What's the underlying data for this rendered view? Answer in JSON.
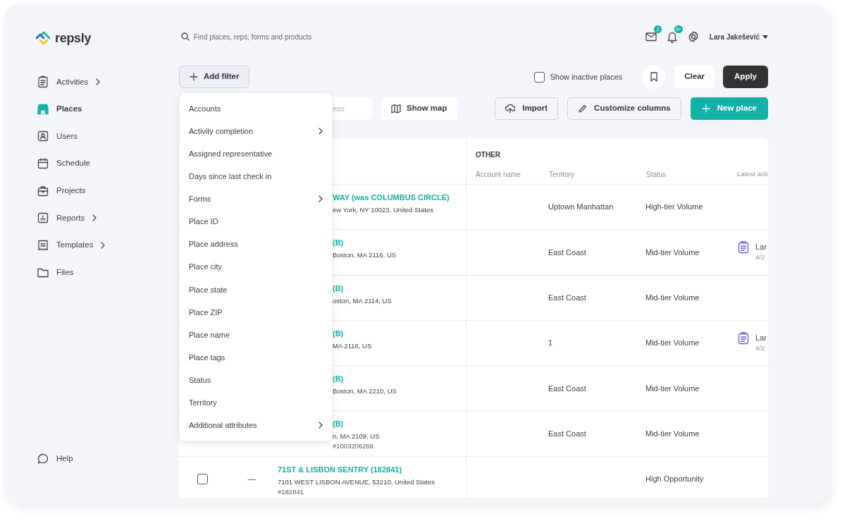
{
  "brand": "repsly",
  "sidebar": {
    "items": [
      {
        "label": "Activities",
        "selected": false,
        "has_submenu": true
      },
      {
        "label": "Places",
        "selected": true,
        "has_submenu": false
      },
      {
        "label": "Users",
        "selected": false,
        "has_submenu": false
      },
      {
        "label": "Schedule",
        "selected": false,
        "has_submenu": false
      },
      {
        "label": "Projects",
        "selected": false,
        "has_submenu": false
      },
      {
        "label": "Reports",
        "selected": false,
        "has_submenu": true
      },
      {
        "label": "Templates",
        "selected": false,
        "has_submenu": true
      },
      {
        "label": "Files",
        "selected": false,
        "has_submenu": false
      }
    ],
    "help": "Help"
  },
  "topbar": {
    "search_placeholder": "Find places, reps, forms and products",
    "messages_badge": "2",
    "notifications_badge": "9+",
    "user": "Lara Jakešević"
  },
  "filter_bar": {
    "add_filter": "Add filter",
    "show_inactive": {
      "label": "Show inactive places",
      "checked": false
    },
    "clear": "Clear",
    "apply": "Apply"
  },
  "filter_menu": [
    {
      "label": "Accounts",
      "has_submenu": false
    },
    {
      "label": "Activity completion",
      "has_submenu": true
    },
    {
      "label": "Assigned representative",
      "has_submenu": false
    },
    {
      "label": "Days since last check in",
      "has_submenu": false
    },
    {
      "label": "Forms",
      "has_submenu": true
    },
    {
      "label": "Place ID",
      "has_submenu": false
    },
    {
      "label": "Place address",
      "has_submenu": false
    },
    {
      "label": "Place city",
      "has_submenu": false
    },
    {
      "label": "Place state",
      "has_submenu": false
    },
    {
      "label": "Place ZIP",
      "has_submenu": false
    },
    {
      "label": "Place name",
      "has_submenu": false
    },
    {
      "label": "Place tags",
      "has_submenu": false
    },
    {
      "label": "Status",
      "has_submenu": false
    },
    {
      "label": "Territory",
      "has_submenu": false
    },
    {
      "label": "Additional attributes",
      "has_submenu": true
    }
  ],
  "actions": {
    "search_placeholder": "ess",
    "show_map": "Show map",
    "import": "Import",
    "customize": "Customize columns",
    "new_place": "New place"
  },
  "table": {
    "group_header": "OTHER",
    "columns": [
      "Account name",
      "Territory",
      "Status",
      "Latest acti"
    ],
    "rows": [
      {
        "name": "WAY (was COLUMBUS CIRCLE)",
        "address": "ew York, NY 10023, United States",
        "territory": "Uptown Manhattan",
        "status": "High-tier Volume"
      },
      {
        "name": "(B)",
        "address": "Boston, MA 2116, US",
        "territory": "East Coast",
        "status": "Mid-tier Volume",
        "activity": {
          "user": "Lar",
          "date": "4/2"
        }
      },
      {
        "name": "(B)",
        "address": "oston, MA 2114, US",
        "territory": "East Coast",
        "status": "Mid-tier Volume"
      },
      {
        "name": "(B)",
        "address": "MA 2116, US",
        "territory": "1",
        "status": "Mid-tier Volume",
        "activity": {
          "user": "Lar",
          "date": "4/2"
        }
      },
      {
        "name": "(B)",
        "address": "Boston, MA 2210, US",
        "territory": "East Coast",
        "status": "Mid-tier Volume"
      },
      {
        "name": "(B)",
        "address": "n, MA 2109, US",
        "id": "#1003206268",
        "territory": "East Coast",
        "status": "Mid-tier Volume"
      },
      {
        "checkbox": {
          "checked": false
        },
        "marker": "—",
        "name": "71ST & LISBON SENTRY (182841)",
        "address": "7101 WEST LISBON AVENUE, 53210, United States",
        "id": "#182841",
        "status": "High Opportunity"
      }
    ]
  }
}
